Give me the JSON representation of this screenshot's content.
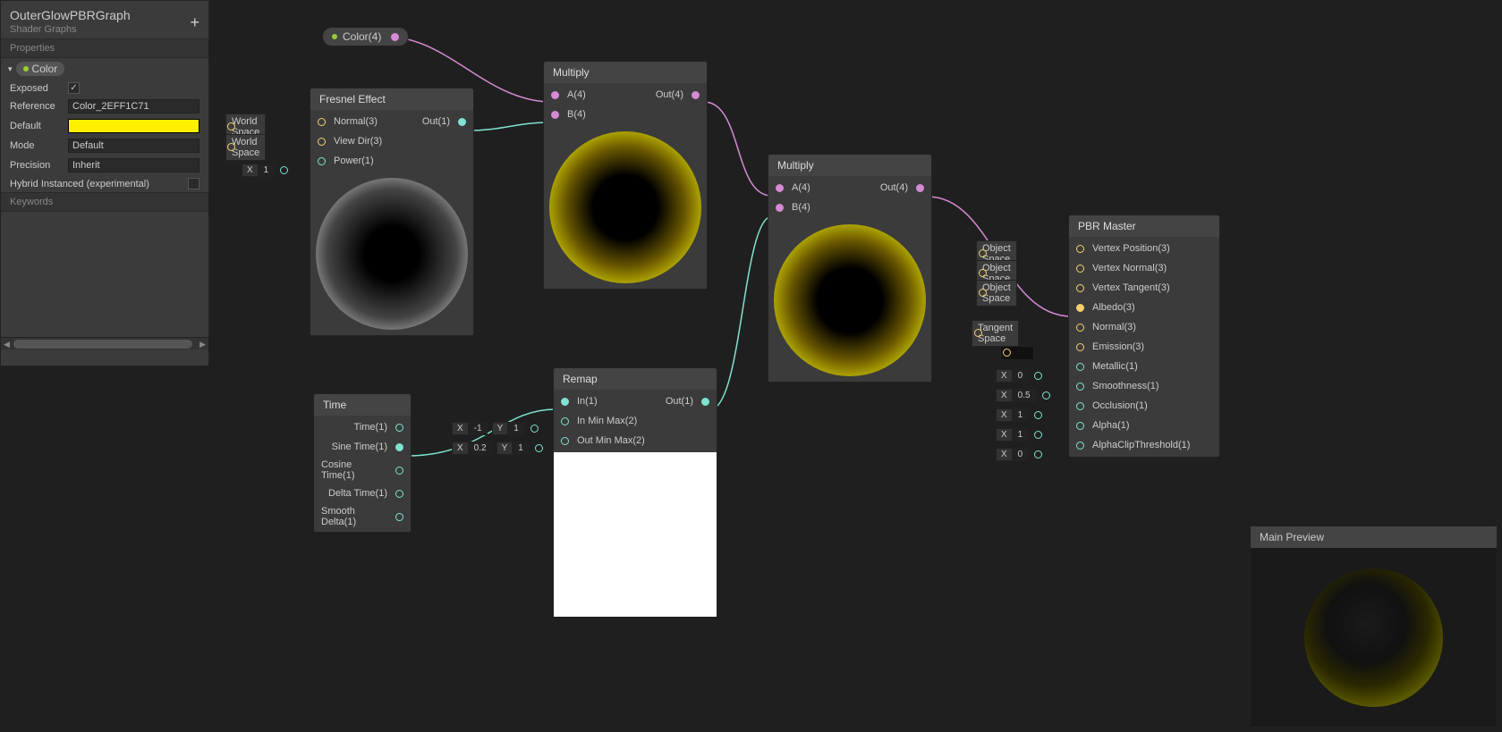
{
  "sidebar": {
    "title": "OuterGlowPBRGraph",
    "subtitle": "Shader Graphs",
    "section_props": "Properties",
    "section_keywords": "Keywords",
    "color_pill": "Color",
    "exposed_label": "Exposed",
    "exposed_checked": "✓",
    "reference_label": "Reference",
    "reference_value": "Color_2EFF1C71",
    "default_label": "Default",
    "mode_label": "Mode",
    "mode_value": "Default",
    "precision_label": "Precision",
    "precision_value": "Inherit",
    "hybrid_label": "Hybrid Instanced (experimental)"
  },
  "pill_color": {
    "label": "Color(4)"
  },
  "fresnel": {
    "title": "Fresnel Effect",
    "normal": "Normal(3)",
    "viewdir": "View Dir(3)",
    "power": "Power(1)",
    "out": "Out(1)",
    "opt_ws1": "World Space",
    "opt_ws2": "World Space",
    "opt_x": "X",
    "opt_x_val": "1"
  },
  "mult1": {
    "title": "Multiply",
    "a": "A(4)",
    "b": "B(4)",
    "out": "Out(4)"
  },
  "mult2": {
    "title": "Multiply",
    "a": "A(4)",
    "b": "B(4)",
    "out": "Out(4)"
  },
  "time": {
    "title": "Time",
    "time": "Time(1)",
    "sine": "Sine Time(1)",
    "cosine": "Cosine Time(1)",
    "delta": "Delta Time(1)",
    "smooth": "Smooth Delta(1)"
  },
  "remap": {
    "title": "Remap",
    "in": "In(1)",
    "inminmax": "In Min Max(2)",
    "outminmax": "Out Min Max(2)",
    "out": "Out(1)",
    "inmin_x": "-1",
    "inmin_y": "1",
    "outmin_x": "0.2",
    "outmin_y": "1"
  },
  "pbr": {
    "title": "PBR Master",
    "vpos": "Vertex Position(3)",
    "vnorm": "Vertex Normal(3)",
    "vtan": "Vertex Tangent(3)",
    "albedo": "Albedo(3)",
    "normal": "Normal(3)",
    "emission": "Emission(3)",
    "metallic": "Metallic(1)",
    "smooth": "Smoothness(1)",
    "occ": "Occlusion(1)",
    "alpha": "Alpha(1)",
    "clip": "AlphaClipThreshold(1)",
    "os": "Object Space",
    "ts": "Tangent Space",
    "x": "X",
    "v_metallic": "0",
    "v_smooth": "0.5",
    "v_occ": "1",
    "v_alpha": "1",
    "v_clip": "0"
  },
  "mainprev": {
    "title": "Main Preview"
  }
}
